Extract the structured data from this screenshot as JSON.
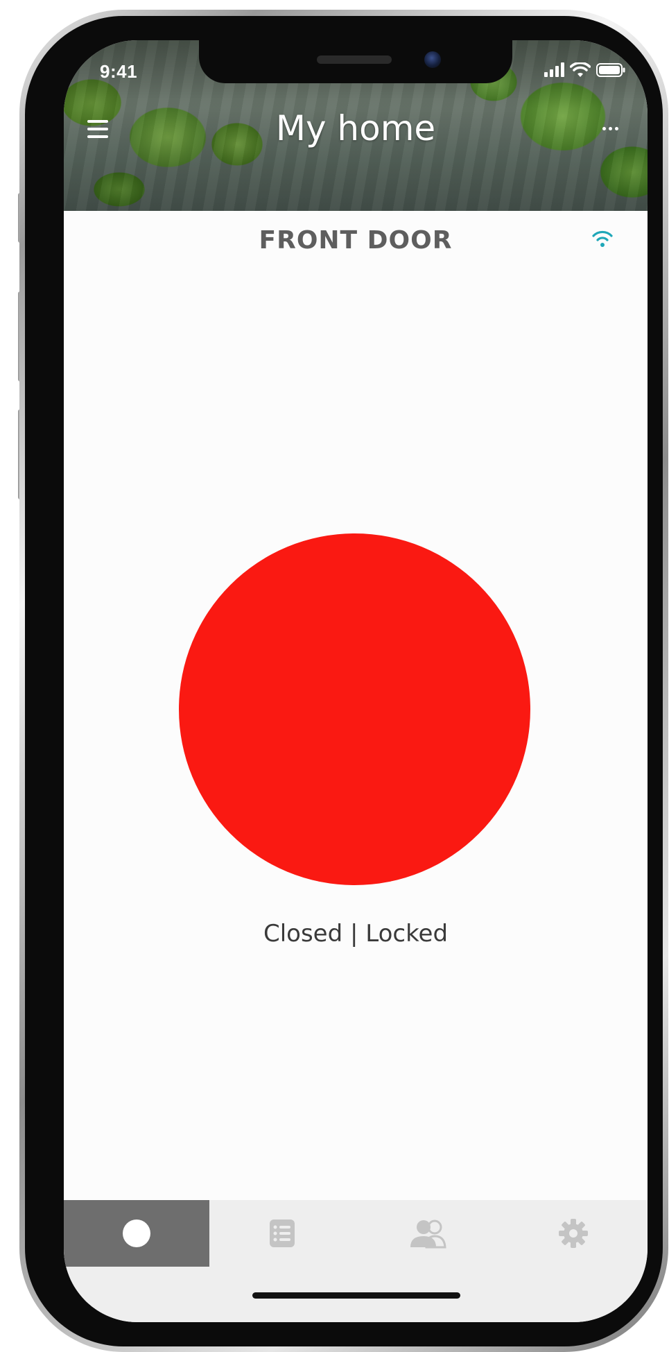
{
  "status_bar": {
    "time": "9:41",
    "icons": [
      "cellular-signal-icon",
      "wifi-icon",
      "battery-icon"
    ]
  },
  "header": {
    "title": "My home",
    "menu_icon": "hamburger-menu-icon",
    "more_icon": "more-dots-icon"
  },
  "lock": {
    "door_name": "FRONT DOOR",
    "connection_icon": "wifi-connection-icon",
    "state_text": "Closed | Locked"
  },
  "tabs": [
    {
      "icon": "lock-circle-icon",
      "active": true
    },
    {
      "icon": "activity-list-icon",
      "active": false
    },
    {
      "icon": "users-icon",
      "active": false
    },
    {
      "icon": "settings-gear-icon",
      "active": false
    }
  ],
  "colors": {
    "lock_state": "#fa1912",
    "connection": "#1fa7b8",
    "active_tab": "#6e6e6e",
    "inactive_icon": "#c4c4c4"
  }
}
